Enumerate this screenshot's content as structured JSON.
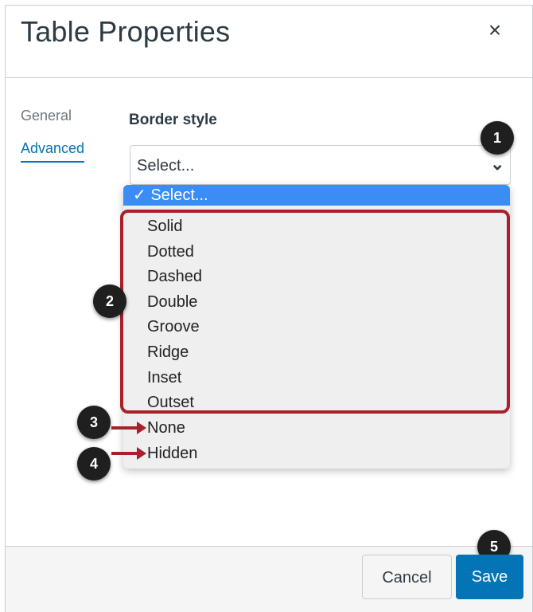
{
  "dialog": {
    "title": "Table Properties",
    "close_glyph": "×"
  },
  "tabs": [
    {
      "label": "General"
    },
    {
      "label": "Advanced"
    }
  ],
  "border_style": {
    "label": "Border style",
    "value": "Select...",
    "chevron_glyph": "⌄",
    "options": [
      {
        "label": "✓ Select...",
        "selected": true
      },
      {
        "label": "Solid"
      },
      {
        "label": "Dotted"
      },
      {
        "label": "Dashed"
      },
      {
        "label": "Double"
      },
      {
        "label": "Groove"
      },
      {
        "label": "Ridge"
      },
      {
        "label": "Inset"
      },
      {
        "label": "Outset"
      },
      {
        "label": "None"
      },
      {
        "label": "Hidden"
      }
    ]
  },
  "callouts": [
    "1",
    "2",
    "3",
    "4",
    "5"
  ],
  "footer": {
    "cancel_label": "Cancel",
    "save_label": "Save"
  },
  "colors": {
    "accent": "#0374b5",
    "highlight": "#3b8cf5",
    "callout_red": "#a8202b"
  }
}
